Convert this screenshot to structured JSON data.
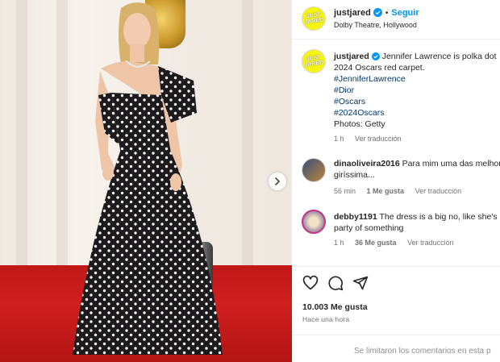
{
  "post": {
    "author": "justjared",
    "avatar_text": "JUST JARED",
    "follow_label": "Seguir",
    "separator": "•",
    "location": "Dolby Theatre, Hollywood"
  },
  "caption": {
    "username": "justjared",
    "line1": "Jennifer Lawrence is polka dot",
    "line2": "2024 Oscars red carpet.",
    "hashtags": [
      "#JenniferLawrence",
      "#Dior",
      "#Oscars",
      "#2024Oscars"
    ],
    "credit": "Photos: Getty",
    "time": "1 h",
    "translate": "Ver traducción"
  },
  "comments": [
    {
      "username": "dinaoliveira2016",
      "line1": "Para mim uma das melhores",
      "line2": "giríssima...",
      "time": "56 min",
      "likes": "1 Me gusta",
      "translate": "Ver traducción"
    },
    {
      "username": "debby1191",
      "line1": "The dress is a big no, like she's g",
      "line2": "party of something",
      "time": "1 h",
      "likes": "36 Me gusta",
      "translate": "Ver traducción"
    }
  ],
  "footer": {
    "likes_count": "10.003 Me gusta",
    "posted_ago": "Hace una hora",
    "comments_limited": "Se limitaron los comentarios en esta p"
  },
  "icons": {
    "like": "heart-icon",
    "comment": "comment-bubble-icon",
    "share": "paper-plane-icon",
    "verified": "verified-badge-icon",
    "next": "chevron-right-icon"
  },
  "colors": {
    "accent": "#0095f6",
    "avatar_bg": "#f5f50e",
    "carpet": "#c91b1b",
    "muted": "#737373"
  }
}
